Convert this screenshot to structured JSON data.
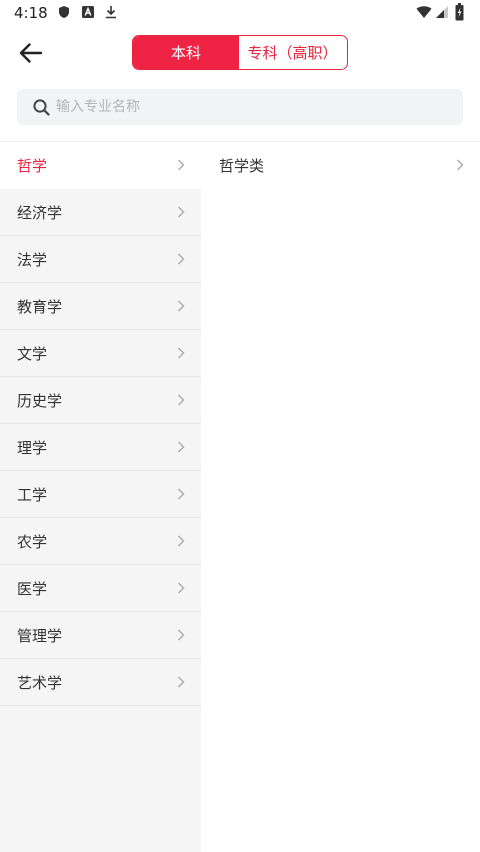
{
  "status_bar": {
    "time": "4:18"
  },
  "tabs": {
    "active_label": "本科",
    "inactive_label": "专科（高职）"
  },
  "search": {
    "placeholder": "输入专业名称",
    "value": ""
  },
  "categories": [
    {
      "label": "哲学",
      "selected": true
    },
    {
      "label": "经济学"
    },
    {
      "label": "法学"
    },
    {
      "label": "教育学"
    },
    {
      "label": "文学"
    },
    {
      "label": "历史学"
    },
    {
      "label": "理学"
    },
    {
      "label": "工学"
    },
    {
      "label": "农学"
    },
    {
      "label": "医学"
    },
    {
      "label": "管理学"
    },
    {
      "label": "艺术学"
    }
  ],
  "subcategories": [
    {
      "label": "哲学类"
    }
  ],
  "colors": {
    "accent": "#e8253f",
    "panel_bg": "#f5f5f5"
  },
  "icons": {
    "back": "arrow-left-icon",
    "search": "search-icon",
    "chevron": "chevron-right-icon"
  }
}
